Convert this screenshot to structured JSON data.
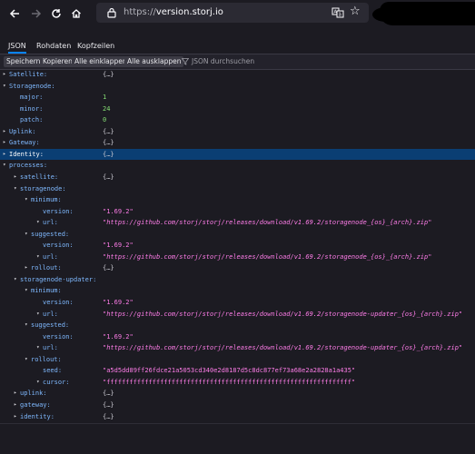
{
  "browser": {
    "url_scheme": "https://",
    "url_host": "version.storj.io",
    "back_icon": "arrow-left-icon",
    "forward_icon": "arrow-right-icon",
    "reload_icon": "reload-icon",
    "home_icon": "home-icon"
  },
  "tabs": [
    "JSON",
    "Rohdaten",
    "Kopfzeilen"
  ],
  "toolbar": {
    "save": "Speichern",
    "copy": "Kopieren",
    "collapse_all": "Alle einklappen",
    "expand_all": "Alle ausklappen",
    "filter_placeholder": "JSON durchsuchen"
  },
  "tree": [
    {
      "key": "Satellite:",
      "val": "{…}",
      "type": "obj",
      "depth": 0,
      "tw": "▸"
    },
    {
      "key": "Storagenode:",
      "val": "",
      "type": "obj",
      "depth": 0,
      "tw": "▾"
    },
    {
      "key": "major:",
      "val": "1",
      "type": "num",
      "depth": 1,
      "tw": ""
    },
    {
      "key": "minor:",
      "val": "24",
      "type": "num",
      "depth": 1,
      "tw": ""
    },
    {
      "key": "patch:",
      "val": "0",
      "type": "num",
      "depth": 1,
      "tw": ""
    },
    {
      "key": "Uplink:",
      "val": "{…}",
      "type": "obj",
      "depth": 0,
      "tw": "▸"
    },
    {
      "key": "Gateway:",
      "val": "{…}",
      "type": "obj",
      "depth": 0,
      "tw": "▸"
    },
    {
      "key": "Identity:",
      "val": "{…}",
      "type": "obj",
      "depth": 0,
      "tw": "▸",
      "selected": true
    },
    {
      "key": "processes:",
      "val": "",
      "type": "obj",
      "depth": 0,
      "tw": "▾"
    },
    {
      "key": "satellite:",
      "val": "{…}",
      "type": "obj",
      "depth": 1,
      "tw": "▸"
    },
    {
      "key": "storagenode:",
      "val": "",
      "type": "obj",
      "depth": 1,
      "tw": "▾"
    },
    {
      "key": "minimum:",
      "val": "",
      "type": "obj",
      "depth": 2,
      "tw": "▾"
    },
    {
      "key": "version:",
      "val": "\"1.69.2\"",
      "type": "str",
      "depth": 3,
      "tw": ""
    },
    {
      "key": "url:",
      "val": "\"https://github.com/storj/storj/releases/download/v1.69.2/storagenode_{os}_{arch}.zip\"",
      "type": "str italic",
      "depth": 3,
      "tw": "▾"
    },
    {
      "key": "suggested:",
      "val": "",
      "type": "obj",
      "depth": 2,
      "tw": "▾"
    },
    {
      "key": "version:",
      "val": "\"1.69.2\"",
      "type": "str",
      "depth": 3,
      "tw": ""
    },
    {
      "key": "url:",
      "val": "\"https://github.com/storj/storj/releases/download/v1.69.2/storagenode_{os}_{arch}.zip\"",
      "type": "str italic",
      "depth": 3,
      "tw": "▾"
    },
    {
      "key": "rollout:",
      "val": "{…}",
      "type": "obj",
      "depth": 2,
      "tw": "▸"
    },
    {
      "key": "storagenode-updater:",
      "val": "",
      "type": "obj",
      "depth": 1,
      "tw": "▾"
    },
    {
      "key": "minimum:",
      "val": "",
      "type": "obj",
      "depth": 2,
      "tw": "▾"
    },
    {
      "key": "version:",
      "val": "\"1.69.2\"",
      "type": "str",
      "depth": 3,
      "tw": ""
    },
    {
      "key": "url:",
      "val": "\"https://github.com/storj/storj/releases/download/v1.69.2/storagenode-updater_{os}_{arch}.zip\"",
      "type": "str italic",
      "depth": 3,
      "tw": "▾"
    },
    {
      "key": "suggested:",
      "val": "",
      "type": "obj",
      "depth": 2,
      "tw": "▾"
    },
    {
      "key": "version:",
      "val": "\"1.69.2\"",
      "type": "str",
      "depth": 3,
      "tw": ""
    },
    {
      "key": "url:",
      "val": "\"https://github.com/storj/storj/releases/download/v1.69.2/storagenode-updater_{os}_{arch}.zip\"",
      "type": "str italic",
      "depth": 3,
      "tw": "▾"
    },
    {
      "key": "rollout:",
      "val": "",
      "type": "obj",
      "depth": 2,
      "tw": "▾"
    },
    {
      "key": "seed:",
      "val": "\"a5d5dd89ff26fdce21a5053cd340e2d8187d5c8dc877ef73a68e2a2828a1a435\"",
      "type": "str",
      "depth": 3,
      "tw": ""
    },
    {
      "key": "cursor:",
      "val": "\"ffffffffffffffffffffffffffffffffffffffffffffffffffffffffffffffff\"",
      "type": "str",
      "depth": 3,
      "tw": "▾"
    },
    {
      "key": "uplink:",
      "val": "{…}",
      "type": "obj",
      "depth": 1,
      "tw": "▸"
    },
    {
      "key": "gateway:",
      "val": "{…}",
      "type": "obj",
      "depth": 1,
      "tw": "▸"
    },
    {
      "key": "identity:",
      "val": "{…}",
      "type": "obj",
      "depth": 1,
      "tw": "▸"
    }
  ]
}
